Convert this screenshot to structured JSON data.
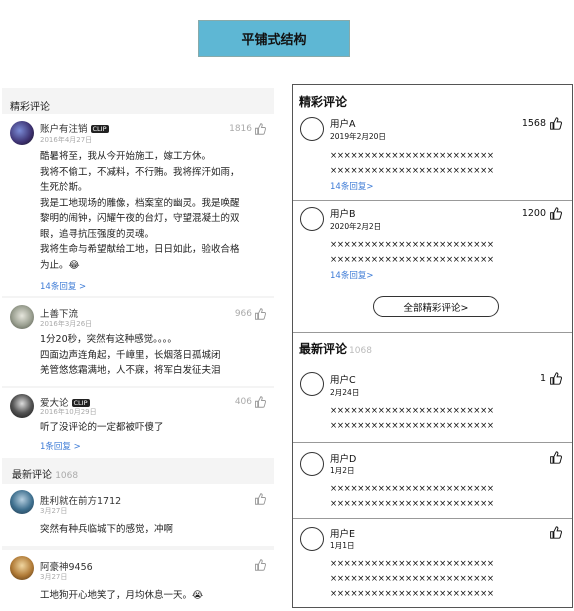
{
  "page_title": "平铺式结构",
  "left": {
    "hot_header": "精彩评论",
    "hot_comments": [
      {
        "user": "账户有注销",
        "badge": "CLIP",
        "date": "2016年4月27日",
        "likes": "1816",
        "lines": [
          "酷暑将至，我从今开始施工，嫁工方休。",
          "我将不偷工，不减料，不行贿。我将挥汗如雨，",
          "生死於斯。",
          "我是工地现场的雕像，档案室的幽灵。我是唤醒",
          "黎明的闹钟，闪耀午夜的台灯，守望混凝土的双",
          "眼，追寻抗压强度的灵魂。",
          "我将生命与希望献给工地，日日如此，验收合格",
          "为止。😂"
        ],
        "reply": "14条回复 >"
      },
      {
        "user": "上善下流",
        "date": "2016年3月26日",
        "likes": "966",
        "lines": [
          "1分20秒，突然有这种感觉。。。。",
          "四面边声连角起，千嶂里，长烟落日孤城闭",
          "羌管悠悠霜满地，人不寐，将军白发征夫泪"
        ]
      },
      {
        "user": "爱大论",
        "badge": "CLIP",
        "date": "2016年10月29日",
        "likes": "406",
        "lines": [
          "听了没评论的一定都被吓傻了"
        ],
        "reply": "1条回复 >"
      }
    ],
    "new_header": "最新评论",
    "new_count": "1068",
    "new_comments": [
      {
        "user": "胜利就在前方1712",
        "date": "3月27日",
        "text": "突然有种兵临城下的感觉，冲啊"
      },
      {
        "user": "阿豪神9456",
        "date": "3月27日",
        "text": "工地狗开心地笑了，月均休息一天。😭"
      }
    ]
  },
  "right": {
    "hot_header": "精彩评论",
    "hot_comments": [
      {
        "user": "用户A",
        "date": "2019年2月20日",
        "likes": "1568",
        "lines": [
          "××××××××××××××××××××××××",
          "××××××××××××××××××××××××"
        ],
        "reply": "14条回复>"
      },
      {
        "user": "用户B",
        "date": "2020年2月2日",
        "likes": "1200",
        "lines": [
          "××××××××××××××××××××××××",
          "××××××××××××××××××××××××"
        ],
        "reply": "14条回复>"
      }
    ],
    "all_button": "全部精彩评论>",
    "new_header": "最新评论",
    "new_count": "1068",
    "new_comments": [
      {
        "user": "用户C",
        "date": "2月24日",
        "likes": "1",
        "lines": [
          "××××××××××××××××××××××××",
          "××××××××××××××××××××××××"
        ]
      },
      {
        "user": "用户D",
        "date": "1月2日",
        "likes": "",
        "lines": [
          "××××××××××××××××××××××××",
          "××××××××××××××××××××××××"
        ]
      },
      {
        "user": "用户E",
        "date": "1月1日",
        "likes": "",
        "lines": [
          "××××××××××××××××××××××××",
          "××××××××××××××××××××××××",
          "××××××××××××××××××××××××"
        ]
      }
    ]
  }
}
